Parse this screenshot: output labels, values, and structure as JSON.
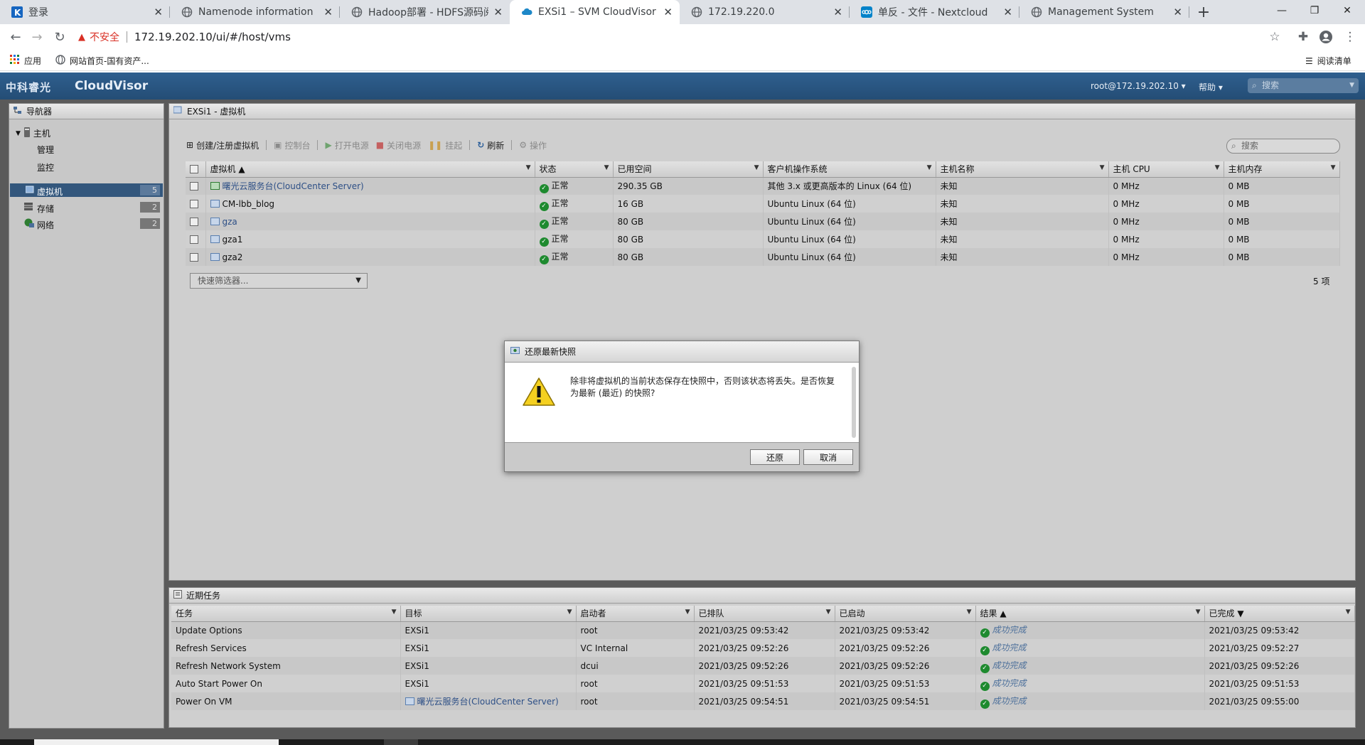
{
  "browser": {
    "tabs": [
      {
        "label": "登录",
        "icon": "k-logo-icon"
      },
      {
        "label": "Namenode information",
        "icon": "globe-icon"
      },
      {
        "label": "Hadoop部署 - HDFS源码阅读与",
        "icon": "globe-icon"
      },
      {
        "label": "EXSi1 – SVM CloudVisor",
        "icon": "cloud-icon"
      },
      {
        "label": "172.19.220.0",
        "icon": "globe-icon"
      },
      {
        "label": "单反 - 文件 - Nextcloud",
        "icon": "nextcloud-icon"
      },
      {
        "label": "Management System",
        "icon": "globe-icon"
      }
    ],
    "active_tab_index": 3,
    "security_label": "不安全",
    "url": "172.19.202.10/ui/#/host/vms",
    "bookmarks": [
      {
        "label": "应用",
        "icon": "apps-grid-icon"
      },
      {
        "label": "网站首页-国有资产...",
        "icon": "globe-icon"
      }
    ],
    "reading_list": "阅读清单"
  },
  "app": {
    "brand_cn": "中科睿光",
    "brand_en": "CloudVisor",
    "user": "root@172.19.202.10 ▾",
    "help": "帮助 ▾",
    "search_placeholder": "搜索"
  },
  "navigator": {
    "title": "导航器",
    "host": "主机",
    "host_children": [
      "管理",
      "监控"
    ],
    "items": [
      {
        "label": "虚拟机",
        "count": "5",
        "selected": true
      },
      {
        "label": "存储",
        "count": "2"
      },
      {
        "label": "网络",
        "count": "2"
      }
    ]
  },
  "vm_panel": {
    "title": "EXSi1 - 虚拟机",
    "toolbar": {
      "create": "创建/注册虚拟机",
      "console": "控制台",
      "power_on": "打开电源",
      "power_off": "关闭电源",
      "suspend": "挂起",
      "refresh": "刷新",
      "actions": "操作"
    },
    "search_placeholder": "搜索",
    "columns": [
      "虚拟机 ▲",
      "状态",
      "已用空间",
      "客户机操作系统",
      "主机名称",
      "主机 CPU",
      "主机内存"
    ],
    "rows": [
      {
        "name": "曙光云服务台(CloudCenter Server)",
        "status": "正常",
        "space": "290.35 GB",
        "os": "其他 3.x 或更高版本的 Linux (64 位)",
        "hostname": "未知",
        "cpu": "0 MHz",
        "mem": "0 MB"
      },
      {
        "name": "CM-lbb_blog",
        "status": "正常",
        "space": "16 GB",
        "os": "Ubuntu Linux (64 位)",
        "hostname": "未知",
        "cpu": "0 MHz",
        "mem": "0 MB"
      },
      {
        "name": "gza",
        "status": "正常",
        "space": "80 GB",
        "os": "Ubuntu Linux (64 位)",
        "hostname": "未知",
        "cpu": "0 MHz",
        "mem": "0 MB"
      },
      {
        "name": "gza1",
        "status": "正常",
        "space": "80 GB",
        "os": "Ubuntu Linux (64 位)",
        "hostname": "未知",
        "cpu": "0 MHz",
        "mem": "0 MB"
      },
      {
        "name": "gza2",
        "status": "正常",
        "space": "80 GB",
        "os": "Ubuntu Linux (64 位)",
        "hostname": "未知",
        "cpu": "0 MHz",
        "mem": "0 MB"
      }
    ],
    "quick_filter": "快速筛选器...",
    "count": "5 项"
  },
  "tasks": {
    "title": "近期任务",
    "columns": [
      "任务",
      "目标",
      "启动者",
      "已排队",
      "已启动",
      "结果 ▲",
      "已完成 ▼"
    ],
    "rows": [
      {
        "task": "Update Options",
        "target": "EXSi1",
        "initiator": "root",
        "queued": "2021/03/25 09:53:42",
        "started": "2021/03/25 09:53:42",
        "result": "成功完成",
        "completed": "2021/03/25 09:53:42"
      },
      {
        "task": "Refresh Services",
        "target": "EXSi1",
        "initiator": "VC Internal",
        "queued": "2021/03/25 09:52:26",
        "started": "2021/03/25 09:52:26",
        "result": "成功完成",
        "completed": "2021/03/25 09:52:27"
      },
      {
        "task": "Refresh Network System",
        "target": "EXSi1",
        "initiator": "dcui",
        "queued": "2021/03/25 09:52:26",
        "started": "2021/03/25 09:52:26",
        "result": "成功完成",
        "completed": "2021/03/25 09:52:26"
      },
      {
        "task": "Auto Start Power On",
        "target": "EXSi1",
        "initiator": "root",
        "queued": "2021/03/25 09:51:53",
        "started": "2021/03/25 09:51:53",
        "result": "成功完成",
        "completed": "2021/03/25 09:51:53"
      },
      {
        "task": "Power On VM",
        "target": "曙光云服务台(CloudCenter Server)",
        "initiator": "root",
        "queued": "2021/03/25 09:54:51",
        "started": "2021/03/25 09:54:51",
        "result": "成功完成",
        "completed": "2021/03/25 09:55:00"
      }
    ]
  },
  "dialog": {
    "title": "还原最新快照",
    "message": "除非将虚拟机的当前状态保存在快照中，否则该状态将丢失。是否恢复为最新 (最近) 的快照?",
    "confirm": "还原",
    "cancel": "取消"
  }
}
